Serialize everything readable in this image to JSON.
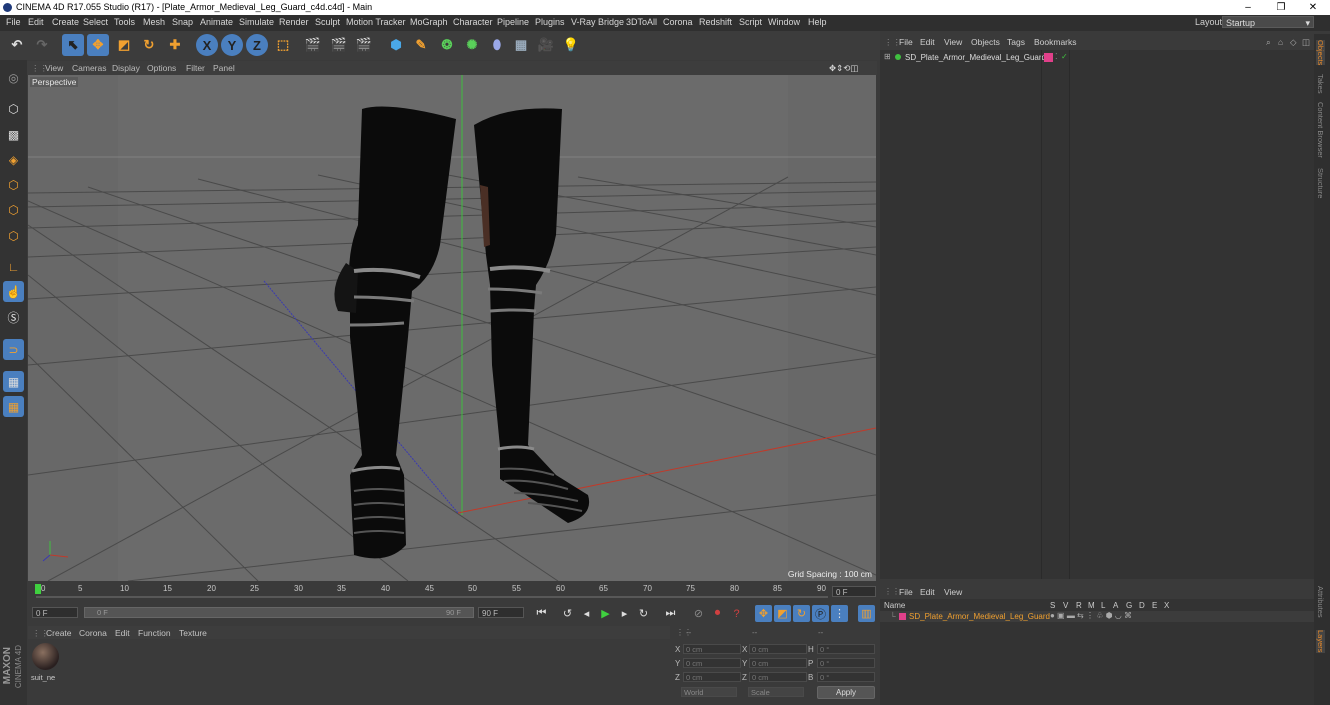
{
  "window": {
    "title": "CINEMA 4D R17.055 Studio (R17) - [Plate_Armor_Medieval_Leg_Guard_c4d.c4d] - Main",
    "minimize": "–",
    "restore": "❐",
    "close": "✕"
  },
  "menu": [
    "File",
    "Edit",
    "Create",
    "Select",
    "Tools",
    "Mesh",
    "Snap",
    "Animate",
    "Simulate",
    "Render",
    "Sculpt",
    "Motion Tracker",
    "MoGraph",
    "Character",
    "Pipeline",
    "Plugins",
    "V-Ray Bridge",
    "3DToAll",
    "Corona",
    "Redshift",
    "Script",
    "Window",
    "Help"
  ],
  "layout": {
    "label": "Layout:",
    "value": "Startup"
  },
  "toolbar_axes": [
    "X",
    "Y",
    "Z"
  ],
  "viewport": {
    "menu": [
      "View",
      "Cameras",
      "Display",
      "Options",
      "Filter",
      "Panel"
    ],
    "label": "Perspective",
    "grid_spacing": "Grid Spacing : 100 cm"
  },
  "timeline": {
    "ticks": [
      "0",
      "5",
      "10",
      "15",
      "20",
      "25",
      "30",
      "35",
      "40",
      "45",
      "50",
      "55",
      "60",
      "65",
      "70",
      "75",
      "80",
      "85",
      "90"
    ],
    "current_frame": "0 F",
    "start_field": "0 F",
    "range_start": "0 F",
    "range_end": "90 F",
    "end_field": "90 F"
  },
  "material_manager": {
    "menu": [
      "Create",
      "Corona",
      "Edit",
      "Function",
      "Texture"
    ],
    "material_name": "suit_ne",
    "brand_1": "MAXON",
    "brand_2": "CINEMA 4D"
  },
  "coordinates": {
    "header": [
      "--",
      "--",
      "--"
    ],
    "rows": [
      {
        "a": "X",
        "av": "0 cm",
        "b": "X",
        "bv": "0 cm",
        "c": "H",
        "cv": "0 °"
      },
      {
        "a": "Y",
        "av": "0 cm",
        "b": "Y",
        "bv": "0 cm",
        "c": "P",
        "cv": "0 °"
      },
      {
        "a": "Z",
        "av": "0 cm",
        "b": "Z",
        "bv": "0 cm",
        "c": "B",
        "cv": "0 °"
      }
    ],
    "mode1": "World",
    "mode2": "Scale",
    "apply": "Apply"
  },
  "object_manager": {
    "menu": [
      "File",
      "Edit",
      "View",
      "Objects",
      "Tags",
      "Bookmarks"
    ],
    "object_name": "SD_Plate_Armor_Medieval_Leg_Guard"
  },
  "layer_manager": {
    "menu": [
      "File",
      "Edit",
      "View"
    ],
    "name_header": "Name",
    "columns": [
      "S",
      "V",
      "R",
      "M",
      "L",
      "A",
      "G",
      "D",
      "E",
      "X"
    ],
    "layer_name": "SD_Plate_Armor_Medieval_Leg_Guard"
  },
  "right_tabs": [
    "Objects",
    "Takes",
    "Content Browser",
    "Structure"
  ],
  "right_tabs_bottom": [
    "Attributes",
    "Layers"
  ],
  "colors": {
    "accent": "#e88a2a",
    "object_tag": "#e0408a",
    "active_blue": "#4a7fbf"
  }
}
